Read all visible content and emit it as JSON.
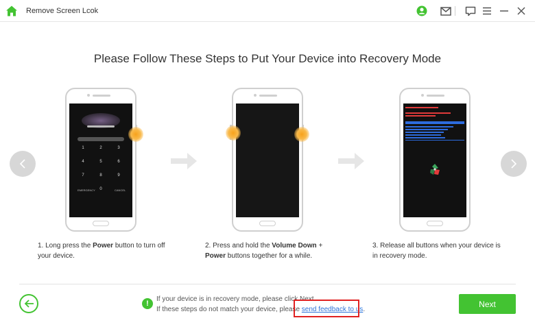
{
  "app": {
    "title": "Remove Screen Lcok",
    "icons": [
      "home-icon",
      "account-icon",
      "mail-icon",
      "feedback-icon",
      "menu-icon",
      "minimize-icon",
      "close-icon"
    ]
  },
  "main": {
    "headline": "Please Follow These Steps to Put Your Device into Recovery Mode",
    "steps": [
      {
        "prefix": "1. Long press the ",
        "bold1": "Power",
        "middle": " button to turn off your device.",
        "bold2": "",
        "suffix": ""
      },
      {
        "prefix": "2. Press and hold the ",
        "bold1": "Volume Down",
        "middle": " + ",
        "bold2": "Power",
        "suffix": " buttons together for a while."
      },
      {
        "prefix": "3. Release all buttons when your device is in recovery mode.",
        "bold1": "",
        "middle": "",
        "bold2": "",
        "suffix": ""
      }
    ],
    "lock_keys": [
      "1",
      "2",
      "3",
      "4",
      "5",
      "6",
      "7",
      "8",
      "9",
      "0"
    ],
    "lock_bottom_left": "EMERGENCY",
    "lock_bottom_right": "CANCEL"
  },
  "footer": {
    "info_line1": "If your device is in recovery mode, please click Next.",
    "info_line2_prefix": "If these steps do not match your device, please ",
    "feedback_link": "send feedback to us",
    "info_line2_suffix": ".",
    "next_label": "Next"
  },
  "colors": {
    "accent_green": "#43c332",
    "link_blue": "#2f73d8",
    "highlight_red": "#e02020",
    "glow_orange": "#f7a21b"
  }
}
